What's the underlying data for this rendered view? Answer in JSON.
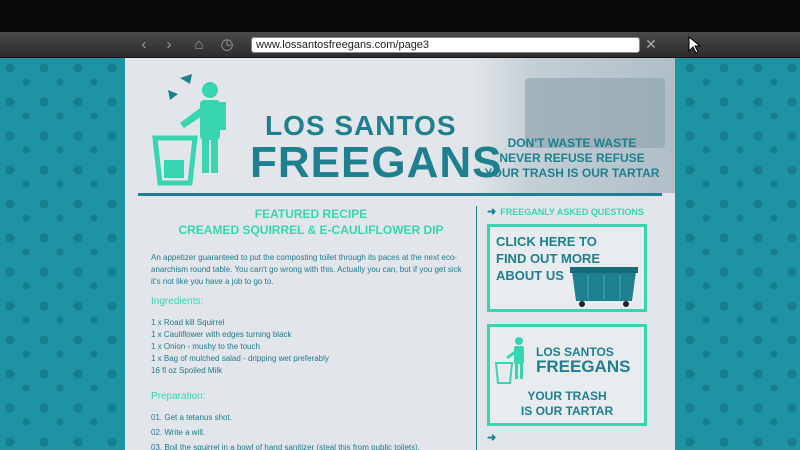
{
  "browser": {
    "url": "www.lossantosfreegans.com/page3",
    "back_label": "‹",
    "forward_label": "›",
    "home_label": "⌂",
    "history_label": "◷",
    "close_label": "✕"
  },
  "header": {
    "title_line1": "LOS SANTOS",
    "title_line2": "FREEGANS",
    "slogan": [
      "DON'T WASTE WASTE",
      "NEVER REFUSE REFUSE",
      "YOUR TRASH IS OUR TARTAR"
    ]
  },
  "recipe": {
    "featured_label": "FEATURED RECIPE",
    "name": "CREAMED SQUIRREL & E-CAULIFLOWER DIP",
    "intro": "An appetizer guaranteed to put the composting toilet through its paces at the next eco-anarchism round table. You can't go wrong with this. Actually you can, but if you get sick it's not like you have a job to go to.",
    "ingredients_label": "Ingredients:",
    "ingredients": [
      "1 x Road kill Squirrel",
      "1 x Cauliflower with edges turning black",
      "1 x Onion - mushy to the touch",
      "1 x Bag of mulched salad - dripping wet preferably",
      "16 fl oz Spoiled Milk"
    ],
    "preparation_label": "Preparation:",
    "steps": [
      "01. Get a tetanus shot.",
      "02. Write a will.",
      "03. Boil the squirrel in a bowl of hand sanitizer (steal this from public toilets)."
    ]
  },
  "sidebar": {
    "faq_heading": "FREEGANLY ASKED QUESTIONS",
    "cta_text": "CLICK HERE TO FIND OUT MORE ABOUT US",
    "mini_logo_line1": "LOS SANTOS",
    "mini_logo_line2": "FREEGANS",
    "mini_slogan_1": "YOUR TRASH",
    "mini_slogan_2": "IS OUR TARTAR"
  },
  "colors": {
    "accent_teal": "#1e7f8e",
    "accent_mint": "#38d5b0",
    "background": "#1d93a4"
  }
}
